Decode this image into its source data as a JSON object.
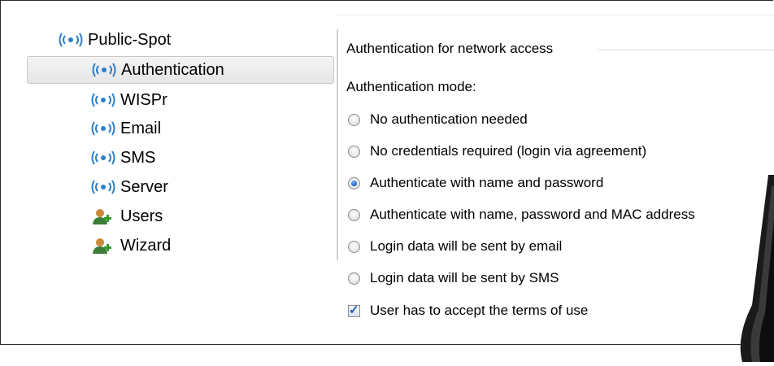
{
  "tree": {
    "items": [
      {
        "label": "Public-Spot",
        "icon": "wifi-icon"
      },
      {
        "label": "Authentication",
        "icon": "wifi-icon",
        "selected": true
      },
      {
        "label": "WISPr",
        "icon": "wifi-icon"
      },
      {
        "label": "Email",
        "icon": "wifi-icon"
      },
      {
        "label": "SMS",
        "icon": "wifi-icon"
      },
      {
        "label": "Server",
        "icon": "wifi-icon"
      },
      {
        "label": "Users",
        "icon": "user-add-icon"
      },
      {
        "label": "Wizard",
        "icon": "user-add-icon"
      }
    ]
  },
  "panel": {
    "group_title": "Authentication for network access",
    "mode_label": "Authentication mode:",
    "options": [
      {
        "label": "No authentication needed",
        "checked": false
      },
      {
        "label": "No credentials required (login via agreement)",
        "checked": false
      },
      {
        "label": "Authenticate with name and password",
        "checked": true
      },
      {
        "label": "Authenticate with name, password and MAC address",
        "checked": false
      },
      {
        "label": "Login data will be sent by email",
        "checked": false
      },
      {
        "label": "Login data will be sent by SMS",
        "checked": false
      }
    ],
    "terms_label": "User has to accept the terms of use",
    "terms_checked": true
  },
  "colors": {
    "radio_selected": "#1f5fb0",
    "wifi_icon": "#2f7fc8",
    "selection_bg": "#e9e9e9"
  }
}
